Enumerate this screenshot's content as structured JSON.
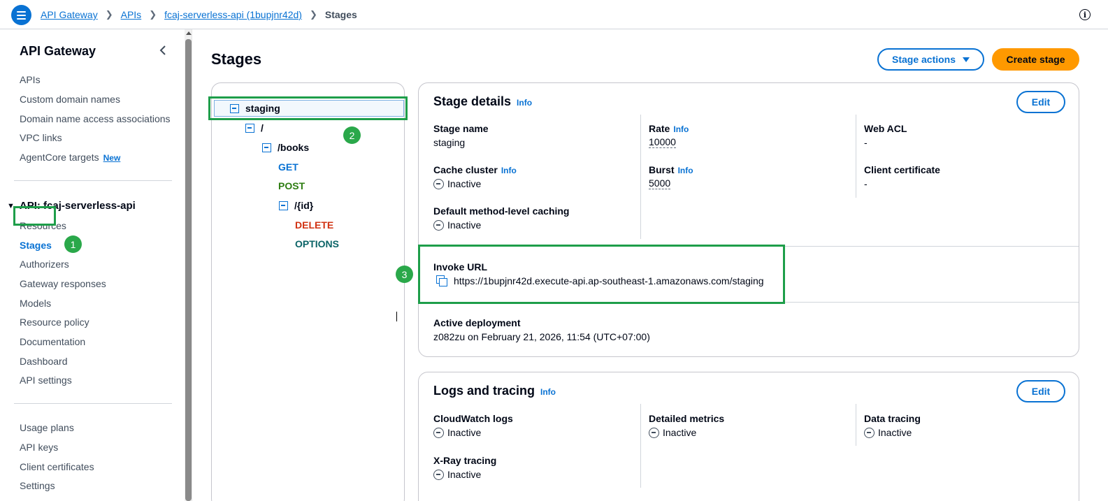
{
  "breadcrumb": {
    "items": [
      "API Gateway",
      "APIs",
      "fcaj-serverless-api (1bupjnr42d)"
    ],
    "current": "Stages"
  },
  "sidebar": {
    "title": "API Gateway",
    "top_items": [
      "APIs",
      "Custom domain names",
      "Domain name access associations",
      "VPC links",
      "AgentCore targets"
    ],
    "new_badge": "New",
    "api_section": "API: fcaj-serverless-api",
    "api_items": [
      "Resources",
      "Stages",
      "Authorizers",
      "Gateway responses",
      "Models",
      "Resource policy",
      "Documentation",
      "Dashboard",
      "API settings"
    ],
    "bottom_items": [
      "Usage plans",
      "API keys",
      "Client certificates",
      "Settings"
    ]
  },
  "annotations": [
    "1",
    "2",
    "3"
  ],
  "main": {
    "title": "Stages",
    "stage_actions_label": "Stage actions",
    "create_stage_label": "Create stage"
  },
  "tree": {
    "staging": "staging",
    "root": "/",
    "books": "/books",
    "get": "GET",
    "post": "POST",
    "id": "/{id}",
    "delete": "DELETE",
    "options": "OPTIONS"
  },
  "stage_details": {
    "title": "Stage details",
    "info": "Info",
    "edit_label": "Edit",
    "stage_name_label": "Stage name",
    "stage_name_value": "staging",
    "rate_label": "Rate",
    "rate_value": "10000",
    "web_acl_label": "Web ACL",
    "web_acl_value": "-",
    "cache_cluster_label": "Cache cluster",
    "cache_cluster_value": "Inactive",
    "burst_label": "Burst",
    "burst_value": "5000",
    "client_cert_label": "Client certificate",
    "client_cert_value": "-",
    "default_caching_label": "Default method-level caching",
    "default_caching_value": "Inactive",
    "invoke_url_label": "Invoke URL",
    "invoke_url_value": "https://1bupjnr42d.execute-api.ap-southeast-1.amazonaws.com/staging",
    "active_deployment_label": "Active deployment",
    "active_deployment_value": "z082zu on February 21, 2026, 11:54 (UTC+07:00)"
  },
  "logs": {
    "title": "Logs and tracing",
    "info": "Info",
    "edit_label": "Edit",
    "cloudwatch_label": "CloudWatch logs",
    "cloudwatch_value": "Inactive",
    "detailed_metrics_label": "Detailed metrics",
    "detailed_metrics_value": "Inactive",
    "data_tracing_label": "Data tracing",
    "data_tracing_value": "Inactive",
    "xray_label": "X-Ray tracing",
    "xray_value": "Inactive"
  },
  "colors": {
    "accent": "#0972d3",
    "primary_button": "#ff9900",
    "highlight": "#1e9e4a"
  }
}
